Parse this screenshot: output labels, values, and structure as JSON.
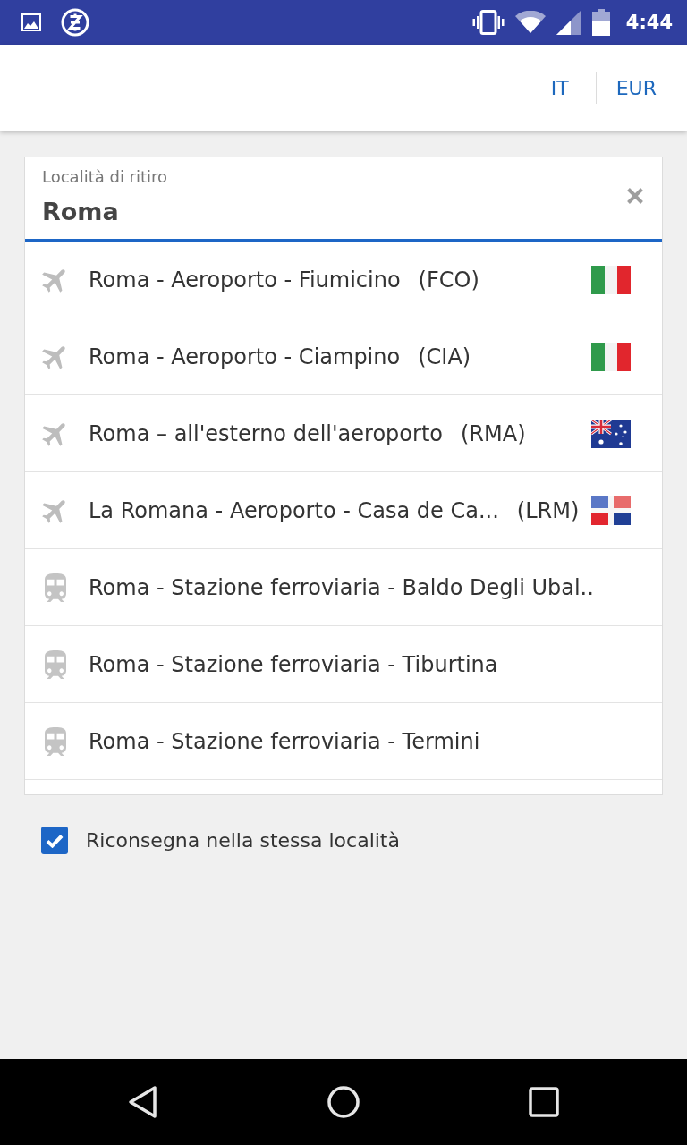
{
  "status_bar": {
    "time": "4:44"
  },
  "header": {
    "language": "IT",
    "currency": "EUR"
  },
  "pickup_field": {
    "label": "Località di ritiro",
    "value": "Roma"
  },
  "suggestions": [
    {
      "kind": "airport",
      "name": "Roma - Aeroporto - Fiumicino",
      "code": "(FCO)",
      "flag": {
        "kind": "italy"
      }
    },
    {
      "kind": "airport",
      "name": "Roma - Aeroporto - Ciampino",
      "code": "(CIA)",
      "flag": {
        "kind": "italy"
      }
    },
    {
      "kind": "airport",
      "name": "Roma – all'esterno dell'aeroporto",
      "code": "(RMA)",
      "flag": {
        "kind": "australia"
      }
    },
    {
      "kind": "airport",
      "name": "La Romana - Aeroporto - Casa de Ca...",
      "code": "(LRM)",
      "flag": {
        "kind": "dominican_republic"
      }
    },
    {
      "kind": "station",
      "name": "Roma - Stazione ferroviaria - Baldo Degli Ubal.."
    },
    {
      "kind": "station",
      "name": "Roma - Stazione ferroviaria - Tiburtina"
    },
    {
      "kind": "station",
      "name": "Roma - Stazione ferroviaria - Termini"
    }
  ],
  "same_location": {
    "label": "Riconsegna nella stessa località",
    "checked": true
  }
}
